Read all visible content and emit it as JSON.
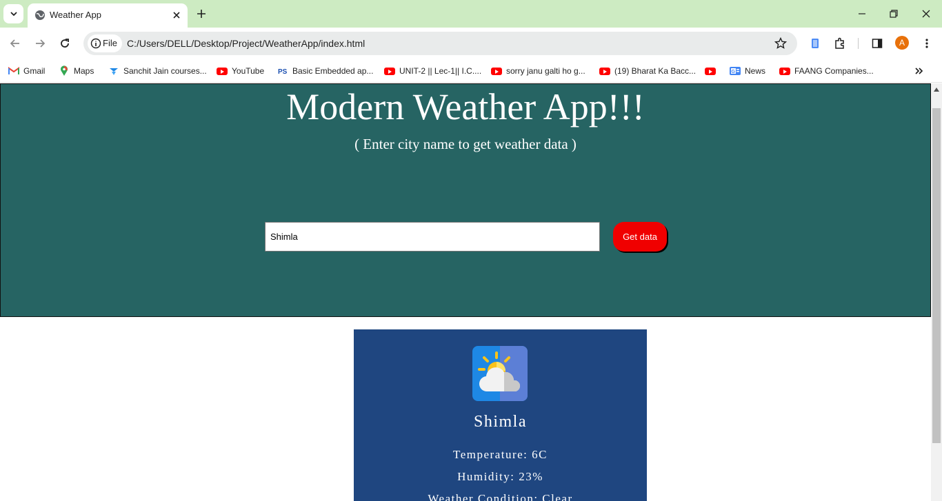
{
  "browser": {
    "tab_title": "Weather App",
    "address_chip": "File",
    "url": "C:/Users/DELL/Desktop/Project/WeatherApp/index.html",
    "profile_initial": "A",
    "bookmarks": [
      {
        "label": "Gmail",
        "icon": "gmail-icon"
      },
      {
        "label": "Maps",
        "icon": "maps-icon"
      },
      {
        "label": "Sanchit Jain courses...",
        "icon": "course-icon"
      },
      {
        "label": "YouTube",
        "icon": "youtube-icon"
      },
      {
        "label": "Basic Embedded ap...",
        "icon": "ps-icon"
      },
      {
        "label": "UNIT-2 || Lec-1|| I.C....",
        "icon": "youtube-icon"
      },
      {
        "label": "sorry janu galti ho g...",
        "icon": "youtube-icon"
      },
      {
        "label": "(19) Bharat Ka Bacc...",
        "icon": "youtube-icon"
      },
      {
        "label": "",
        "icon": "youtube-icon"
      },
      {
        "label": "News",
        "icon": "news-icon"
      },
      {
        "label": "FAANG Companies...",
        "icon": "youtube-icon"
      }
    ]
  },
  "page": {
    "title": "Modern Weather App!!!",
    "subtitle": "( Enter city name to get weather data )",
    "search": {
      "value": "Shimla",
      "placeholder": ""
    },
    "button_label": "Get data",
    "weather": {
      "city": "Shimla",
      "temperature": "Temperature: 6C",
      "humidity": "Humidity: 23%",
      "condition": "Weather Condition: Clear",
      "icon": "partly-cloudy-icon"
    }
  },
  "colors": {
    "hero_bg": "#266463",
    "card_bg": "#1f4680",
    "button_bg": "#f00000",
    "tabbar_bg": "#cdebc2"
  }
}
